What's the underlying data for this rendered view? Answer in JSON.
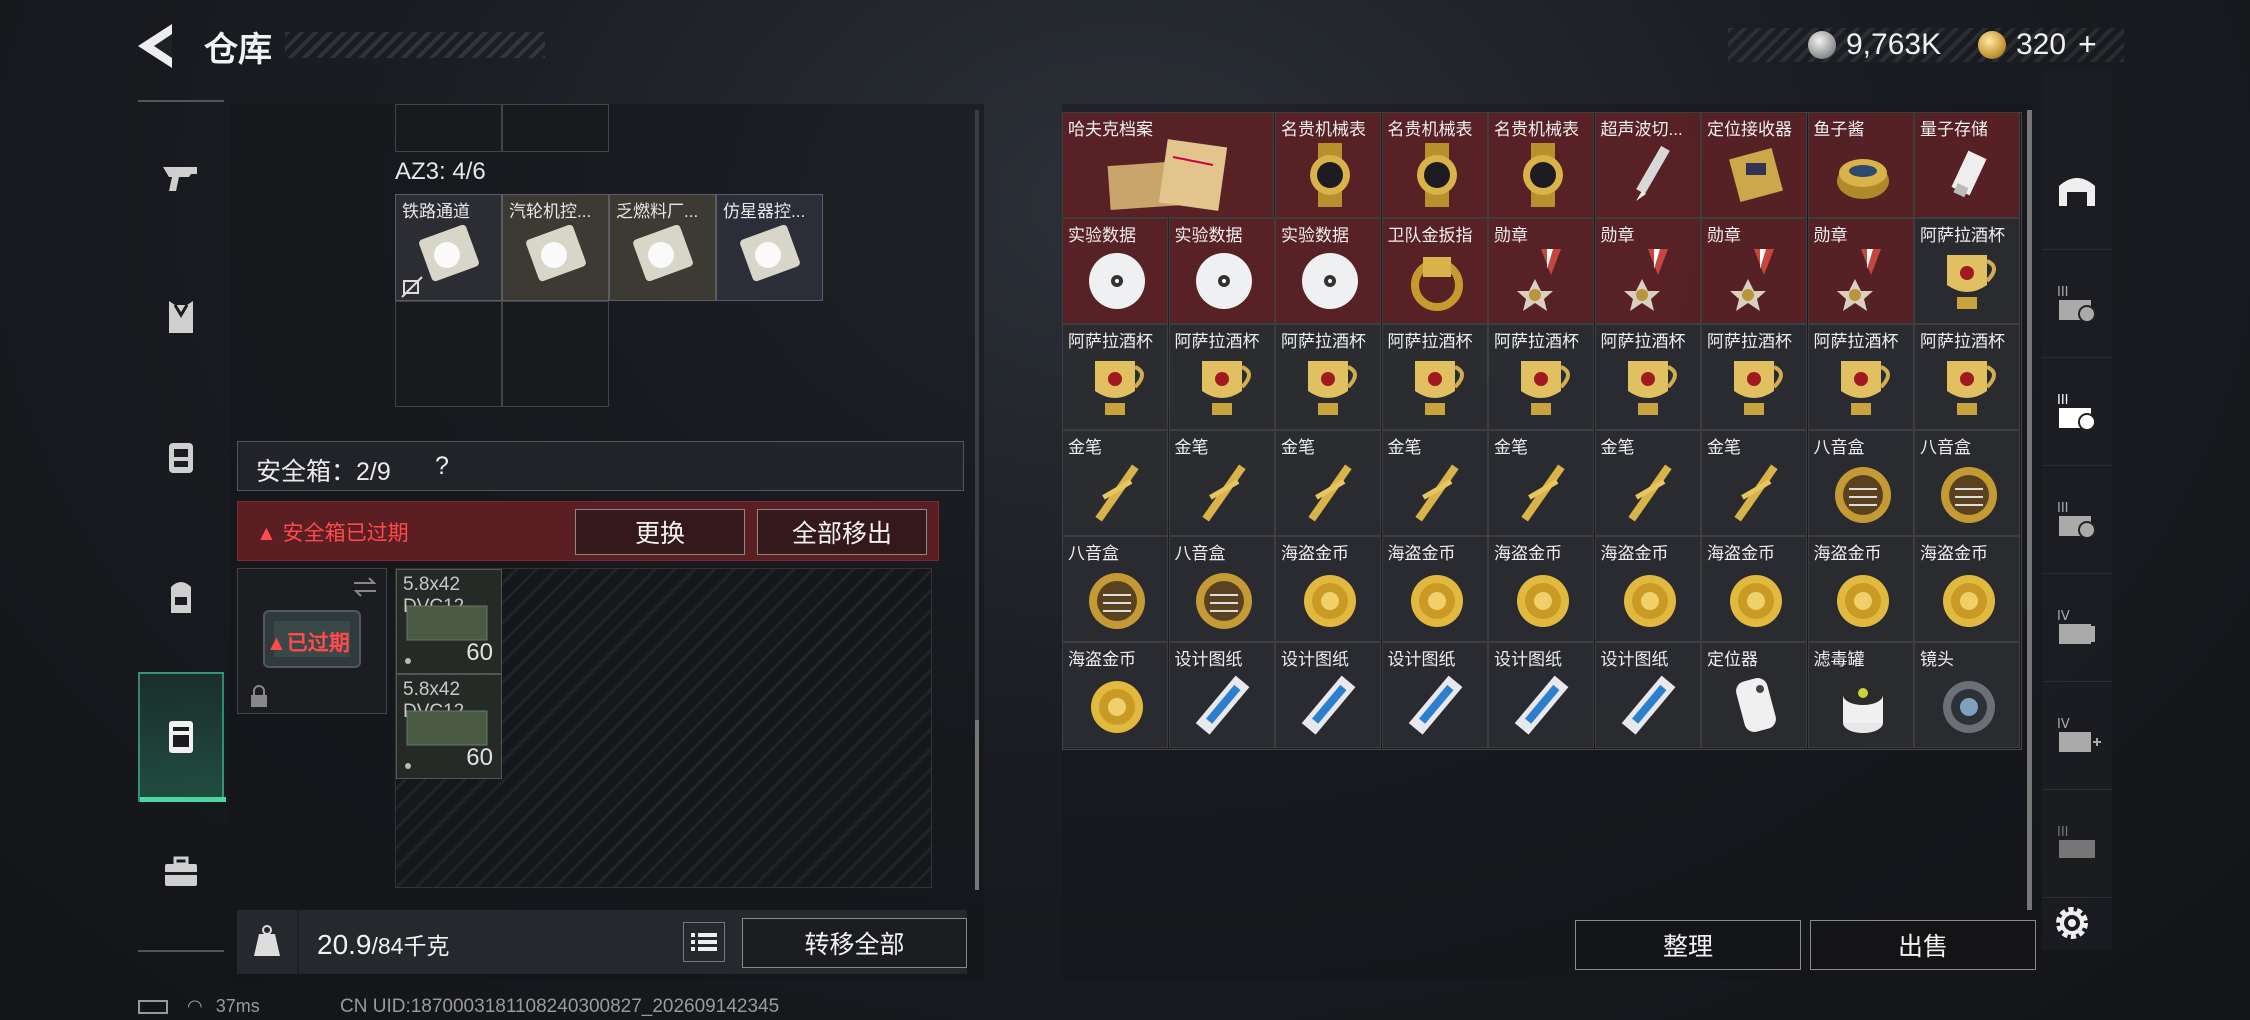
{
  "header": {
    "title": "仓库",
    "silver_value": "9,763K",
    "gold_value": "320",
    "gold_plus": "+"
  },
  "az3": {
    "label": "AZ3: 4/6",
    "items": [
      "铁路通道",
      "汽轮机控...",
      "乏燃料厂...",
      "仿星器控..."
    ]
  },
  "safe_box": {
    "title": "安全箱：2/9",
    "help": "?",
    "expired_warning": "▲ 安全箱已过期",
    "replace_label": "更换",
    "move_all_label": "全部移出",
    "expired_badge": "▲已过期",
    "ammo": [
      {
        "name": "5.8x42 DVC12",
        "count": "60"
      },
      {
        "name": "5.8x42 DVC12",
        "count": "60"
      }
    ]
  },
  "bottom_left": {
    "weight_value": "20.9",
    "weight_unit": "/84千克",
    "transfer_all_label": "转移全部"
  },
  "grid_items": [
    "哈夫克档案",
    "名贵机械表",
    "名贵机械表",
    "名贵机械表",
    "超声波切...",
    "定位接收器",
    "鱼子酱",
    "量子存储",
    "实验数据",
    "实验数据",
    "实验数据",
    "卫队金扳指",
    "勋章",
    "勋章",
    "勋章",
    "勋章",
    "阿萨拉酒杯",
    "阿萨拉酒杯",
    "阿萨拉酒杯",
    "阿萨拉酒杯",
    "阿萨拉酒杯",
    "阿萨拉酒杯",
    "阿萨拉酒杯",
    "阿萨拉酒杯",
    "阿萨拉酒杯",
    "阿萨拉酒杯",
    "金笔",
    "金笔",
    "金笔",
    "金笔",
    "金笔",
    "金笔",
    "金笔",
    "八音盒",
    "八音盒",
    "八音盒",
    "八音盒",
    "海盗金币",
    "海盗金币",
    "海盗金币",
    "海盗金币",
    "海盗金币",
    "海盗金币",
    "海盗金币",
    "海盗金币",
    "设计图纸",
    "设计图纸",
    "设计图纸",
    "设计图纸",
    "设计图纸",
    "定位器",
    "滤毒罐",
    "镜头"
  ],
  "actions": {
    "sort_label": "整理",
    "sell_label": "出售"
  },
  "status": {
    "ping": "37ms",
    "uid": "CN UID:18700031811082403008​27_202609142345"
  },
  "colors": {
    "accent_green": "#4ed6a2",
    "warning_red": "#ff4b4b",
    "rare_cell": "#5c2226"
  }
}
